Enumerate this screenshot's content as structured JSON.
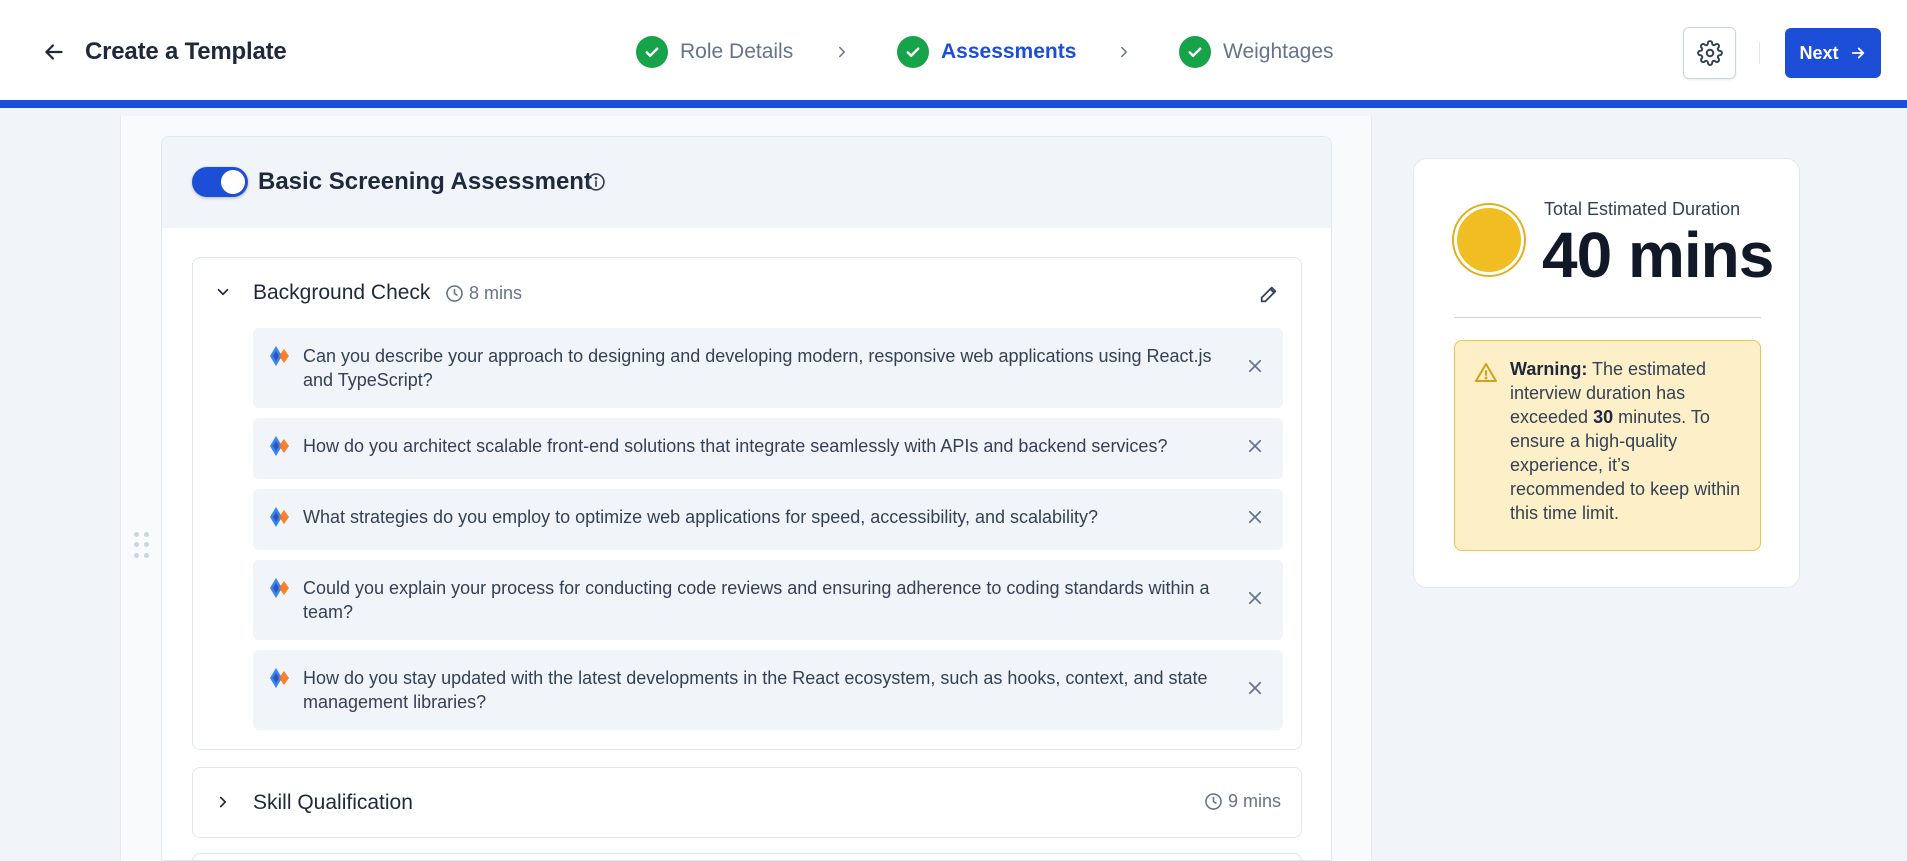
{
  "header": {
    "title": "Create a Template",
    "steps": [
      {
        "label": "Role Details",
        "state": "completed"
      },
      {
        "label": "Assessments",
        "state": "current"
      },
      {
        "label": "Weightages",
        "state": "completed"
      }
    ],
    "next_label": "Next"
  },
  "assessment": {
    "title": "Basic Screening Assessment",
    "enabled": true,
    "sections": [
      {
        "title": "Background Check",
        "duration": "8 mins",
        "expanded": true,
        "questions": [
          "Can you describe your approach to designing and developing modern, responsive web applications using React.js and TypeScript?",
          "How do you architect scalable front-end solutions that integrate seamlessly with APIs and backend services?",
          "What strategies do you employ to optimize web applications for speed, accessibility, and scalability?",
          "Could you explain your process for conducting code reviews and ensuring adherence to coding standards within a team?",
          "How do you stay updated with the latest developments in the React ecosystem, such as hooks, context, and state management libraries?"
        ]
      },
      {
        "title": "Skill Qualification",
        "duration": "9 mins",
        "expanded": false
      }
    ]
  },
  "summary": {
    "label": "Total Estimated Duration",
    "value": "40 mins",
    "warning": {
      "prefix": "Warning:",
      "text_before": "The estimated interview duration has exceeded",
      "limit": "30",
      "text_after": "minutes. To ensure a high-quality experience, it’s recommended to keep within this time limit."
    }
  },
  "colors": {
    "primary": "#1d4ed8",
    "success": "#16a34a",
    "duration_dot": "#f0bd22",
    "warning_bg": "#fdf0c9",
    "warning_border": "#f0c24a"
  },
  "icons": [
    "back-arrow-icon",
    "check-icon",
    "chevron-right-icon",
    "gear-icon",
    "arrow-right-icon",
    "info-icon",
    "chevron-down-icon",
    "clock-icon",
    "pencil-icon",
    "ai-sparkle-icon",
    "close-icon",
    "drag-handle-icon",
    "warning-icon"
  ]
}
